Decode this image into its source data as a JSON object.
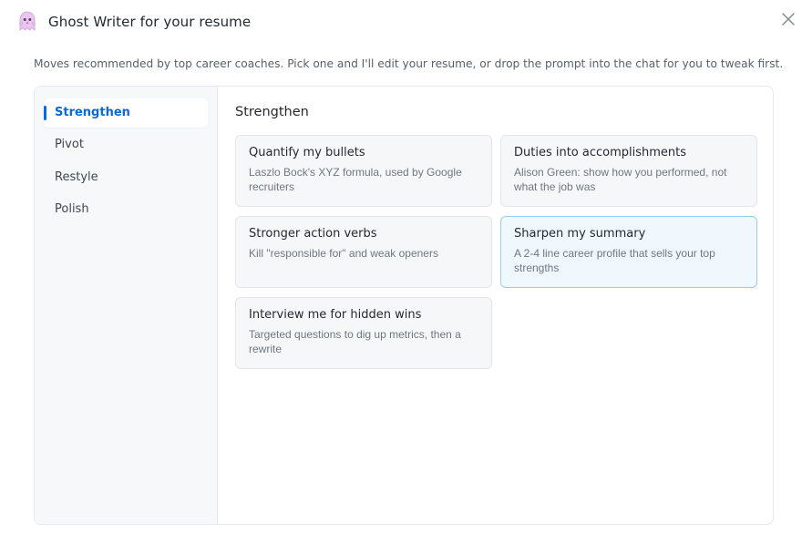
{
  "header": {
    "title": "Ghost Writer for your resume",
    "icon": "ghost-icon",
    "close_icon": "close-icon"
  },
  "subtitle": "Moves recommended by top career coaches. Pick one and I'll edit your resume, or drop the prompt into the chat for you to tweak first.",
  "sidebar": {
    "items": [
      {
        "label": "Strengthen",
        "active": true
      },
      {
        "label": "Pivot"
      },
      {
        "label": "Restyle"
      },
      {
        "label": "Polish"
      }
    ]
  },
  "main": {
    "section_title": "Strengthen",
    "cards": [
      {
        "title": "Quantify my bullets",
        "description": "Laszlo Bock's XYZ formula, used by Google recruiters"
      },
      {
        "title": "Duties into accomplishments",
        "description": "Alison Green: show how you performed, not what the job was"
      },
      {
        "title": "Stronger action verbs",
        "description": "Kill \"responsible for\" and weak openers"
      },
      {
        "title": "Sharpen my summary",
        "description": "A 2-4 line career profile that sells your top strengths",
        "highlighted": true
      },
      {
        "title": "Interview me for hidden wins",
        "description": "Targeted questions to dig up metrics, then a rewrite"
      }
    ]
  },
  "colors": {
    "accent": "#0969da",
    "highlight_border": "#9ccaeb",
    "highlight_bg": "#f1f8fd",
    "ghost": "#e9c6ee"
  }
}
